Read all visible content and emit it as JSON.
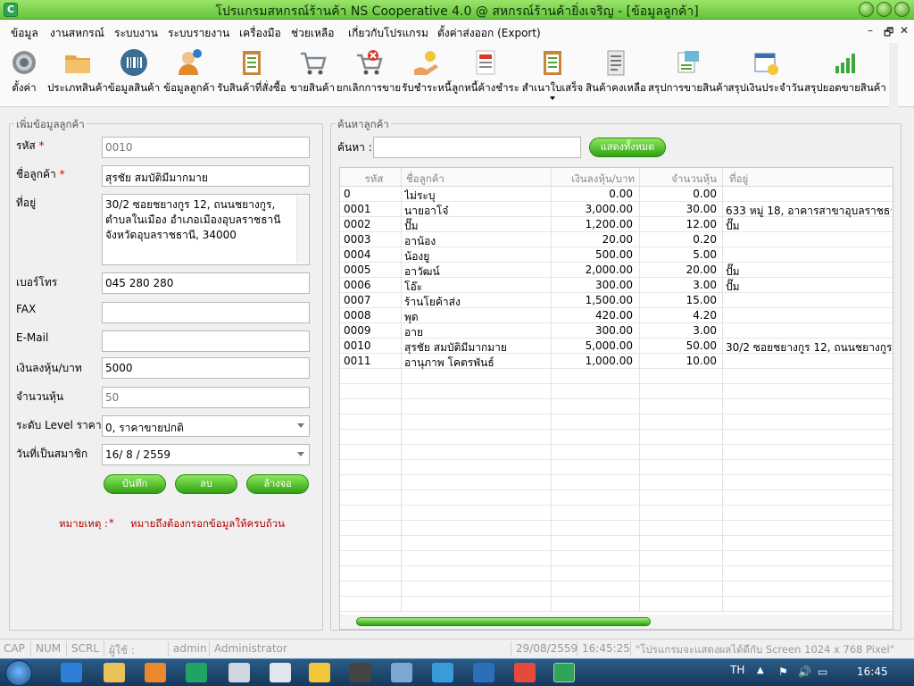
{
  "window": {
    "app_icon_letter": "C",
    "title": "โปรแกรมสหกรณ์ร้านค้า NS Cooperative 4.0 @ สหกรณ์ร้านค้ายิ่งเจริญ - [ข้อมูลลูกค้า]"
  },
  "menu": {
    "items": [
      "ข้อมูล",
      "งานสหกรณ์",
      "ระบบงาน",
      "ระบบรายงาน",
      "เครื่องมือ",
      "ช่วยเหลือ",
      "เกี่ยวกับโปรแกรม",
      "ตั้งค่าส่งออก (Export)"
    ],
    "mdi": [
      "–",
      "🗗",
      "✕"
    ]
  },
  "toolbar": {
    "items": [
      {
        "label": "ตั้งค่า",
        "icon": "gear-icon"
      },
      {
        "label": "ประเภทสินค้า",
        "icon": "folder-icon"
      },
      {
        "label": "ข้อมูลสินค้า",
        "icon": "barcode-icon"
      },
      {
        "label": "ข้อมูลลูกค้า",
        "icon": "customer-icon"
      },
      {
        "label": "รับสินค้าที่สั่งซื้อ",
        "icon": "clipboard-icon"
      },
      {
        "label": "ขายสินค้า",
        "icon": "cart-icon"
      },
      {
        "label": "ยกเลิกการขาย",
        "icon": "cart-cancel-icon"
      },
      {
        "label": "รับชำระหนี้",
        "icon": "payment-icon"
      },
      {
        "label": "ลูกหนี้ค้างชำระ",
        "icon": "invoice-icon"
      },
      {
        "label": "สำเนาใบเสร็จ",
        "icon": "receipt-icon"
      },
      {
        "label": "สินค้าคงเหลือ",
        "icon": "stock-icon"
      },
      {
        "label": "สรุปการขายสินค้า",
        "icon": "sales-report-icon"
      },
      {
        "label": "สรุปเงินประจำวัน",
        "icon": "calendar-icon"
      },
      {
        "label": "สรุปยอดขายสินค้า",
        "icon": "chart-icon"
      }
    ]
  },
  "form": {
    "group_title": "เพิ่มข้อมูลลูกค้า",
    "fields": {
      "code": {
        "label": "รหัส",
        "required_mark": "*",
        "value": "0010"
      },
      "name": {
        "label": "ชื่อลูกค้า",
        "required_mark": "*",
        "value": "สุรชัย สมบัติมีมากมาย"
      },
      "address": {
        "label": "ที่อยู่",
        "value": "30/2 ซอยชยางกูร 12, ถนนชยางกูร, ตำบลในเมือง อำเภอเมืองอุบลราชธานี จังหวัดอุบลราชธานี, 34000"
      },
      "phone": {
        "label": "เบอร์โทร",
        "value": "045 280 280"
      },
      "fax": {
        "label": "FAX",
        "value": ""
      },
      "email": {
        "label": "E-Mail",
        "value": ""
      },
      "investment": {
        "label": "เงินลงหุ้น/บาท",
        "value": "5000"
      },
      "shares": {
        "label": "จำนวนหุ้น",
        "value": "50"
      },
      "price_level": {
        "label": "ระดับ Level ราคา",
        "value": "0, ราคาขายปกติ"
      },
      "member_date": {
        "label": "วันที่เป็นสมาชิก",
        "value": "16/ 8 / 2559"
      }
    },
    "buttons": {
      "save": "บันทึก",
      "delete": "ลบ",
      "clear": "ล้างจอ"
    },
    "note_label": "หมายเหตุ :",
    "note_mark": "*",
    "note_text": "หมายถึงต้องกรอกข้อมูลให้ครบถ้วน"
  },
  "search": {
    "group_title": "ค้นหาลูกค้า",
    "label": "ค้นหา :",
    "value": "",
    "show_all_button": "แสดงทั้งหมด"
  },
  "table": {
    "columns": [
      "รหัส",
      "ชื่อลูกค้า",
      "เงินลงหุ้น/บาท",
      "จำนวนหุ้น",
      "ที่อยู่"
    ],
    "rows": [
      [
        "0",
        "ไม่ระบุ",
        "0.00",
        "0.00",
        ""
      ],
      [
        "0001",
        "นายอาโจ๋",
        "3,000.00",
        "30.00",
        "633 หมู่ 18, อาคารสาขาอุบลราชธานี, ถน"
      ],
      [
        "0002",
        "ปั๊ม",
        "1,200.00",
        "12.00",
        "ปั๊ม"
      ],
      [
        "0003",
        "อาน้อง",
        "20.00",
        "0.20",
        ""
      ],
      [
        "0004",
        "น้องยู",
        "500.00",
        "5.00",
        ""
      ],
      [
        "0005",
        "อาวัฒน์",
        "2,000.00",
        "20.00",
        "ปั๊ม"
      ],
      [
        "0006",
        "โอ๊ะ",
        "300.00",
        "3.00",
        "ปั๊ม"
      ],
      [
        "0007",
        "ร้านโยค้าส่ง",
        "1,500.00",
        "15.00",
        ""
      ],
      [
        "0008",
        "พุด",
        "420.00",
        "4.20",
        ""
      ],
      [
        "0009",
        "อาย",
        "300.00",
        "3.00",
        ""
      ],
      [
        "0010",
        "สุรชัย สมบัติมีมากมาย",
        "5,000.00",
        "50.00",
        "30/2 ซอยชยางกูร 12, ถนนชยางกูร, ตำบ"
      ],
      [
        "0011",
        "อานุภาพ โคตรพันธ์",
        "1,000.00",
        "10.00",
        ""
      ]
    ]
  },
  "statusbar": {
    "cap": "CAP",
    "num": "NUM",
    "scrl": "SCRL",
    "user_label": "ผู้ใช้ :",
    "user_id": "admin",
    "user_name": "Administrator",
    "date": "29/08/2559",
    "time": "16:45:25",
    "message": "\"โปรแกรมจะแสดงผลได้ดีกับ  Screen 1024 x 768 Pixel\""
  },
  "taskbar": {
    "lang": "TH",
    "clock": "16:45"
  },
  "colors": {
    "accent_green": "#2fa012",
    "title_green": "#63c33a",
    "required_red": "#d00000",
    "taskbar_blue": "#1f4a72"
  }
}
